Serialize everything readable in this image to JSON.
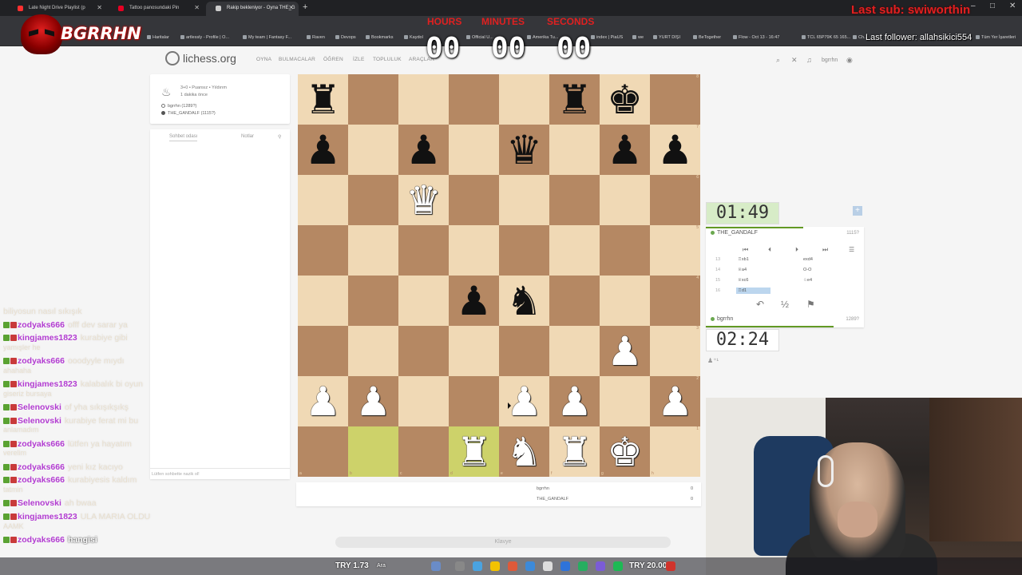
{
  "browser": {
    "tabs": [
      {
        "label": "Late Night Drive Playlist (p",
        "color": "#ff3030"
      },
      {
        "label": "Tattoo panosundaki Pin",
        "color": "#e60023"
      },
      {
        "label": "Rakip bekleniyor - Oyna THE_G",
        "color": "#cccccc"
      }
    ],
    "new_tab": "+",
    "window_controls": [
      "–",
      "□",
      "✕"
    ],
    "bookmarks": [
      "Haritalar",
      "artlessly - Profile | O...",
      "My team | Fantasy F...",
      "Raven",
      "Devops",
      "Bookmarks",
      "Kaydol",
      "Official U...",
      "Amerika Tu...",
      "index | PiaUS",
      "we",
      "YURT DIŞI",
      "BeTogether",
      "Flow - Oct 13 - 16:47",
      "TCL 65P79K 65 165...",
      "Ch...",
      "Tüm Yer İşaretleri"
    ]
  },
  "site": {
    "logo": "lichess.org",
    "nav": [
      "OYNA",
      "BULMACALAR",
      "ÖĞREN",
      "İZLE",
      "TOPLULUK",
      "ARAÇLAR"
    ],
    "header_icons": [
      "search-icon",
      "close-icon",
      "bell-icon"
    ],
    "username": "bgrrhn"
  },
  "game_info": {
    "line1": "3+0 • Puansız • Yıldırım",
    "line2": "1 dakika önce",
    "white_player": "bgrrhn (1289?)",
    "black_player": "THE_GANDALF (1115?)"
  },
  "chat": {
    "tab_chat": "Sohbet odası",
    "tab_notes": "Notlar",
    "placeholder": "Lütfen sohbette nazik ol!"
  },
  "board": {
    "ranks": [
      "8",
      "7",
      "6",
      "5",
      "4",
      "3",
      "2",
      "1"
    ],
    "files": [
      "a",
      "b",
      "c",
      "d",
      "e",
      "f",
      "g",
      "h"
    ],
    "position": [
      [
        "bR",
        "",
        "",
        "",
        "",
        "bR",
        "bK",
        ""
      ],
      [
        "bP",
        "",
        "bP",
        "",
        "bQ",
        "",
        "bP",
        "bP"
      ],
      [
        "",
        "",
        "wQ",
        "",
        "",
        "",
        "",
        ""
      ],
      [
        "",
        "",
        "",
        "",
        "",
        "",
        "",
        ""
      ],
      [
        "",
        "",
        "",
        "bP",
        "bN",
        "",
        "",
        ""
      ],
      [
        "",
        "",
        "",
        "",
        "",
        "",
        "wP",
        ""
      ],
      [
        "wP",
        "wP",
        "",
        "",
        "wP",
        "wP",
        "",
        "wP"
      ],
      [
        "",
        "",
        "",
        "wR",
        "wN",
        "wR",
        "wK",
        ""
      ]
    ],
    "highlight": [
      "b1",
      "d1"
    ]
  },
  "materials": {
    "rows": [
      {
        "name": "bgrrhn",
        "score": "0"
      },
      {
        "name": "THE_GANDALF",
        "score": "0"
      }
    ]
  },
  "keyboard_label": "Klavye",
  "clocks": {
    "top": "01:49",
    "bottom": "02:24"
  },
  "move_panel": {
    "top_player": "THE_GANDALF",
    "top_rating": "1115?",
    "bottom_player": "bgrrhn",
    "bottom_rating": "1289?",
    "moves": [
      {
        "n": "13",
        "w": "♖xb1",
        "b": "exd4"
      },
      {
        "n": "14",
        "w": "♕a4",
        "b": "O-O"
      },
      {
        "n": "15",
        "w": "♕xc6",
        "b": "♘e4"
      },
      {
        "n": "16",
        "w": "♖d1",
        "b": ""
      }
    ],
    "actions": {
      "takeback": "↶",
      "draw": "½",
      "resign": "⚑"
    },
    "add_time": "+"
  },
  "overlay": {
    "brand": "BGRRHN",
    "timer_labels": [
      "HOURS",
      "MINUTES",
      "SECONDS"
    ],
    "timer_values": [
      "00",
      "00",
      "00"
    ],
    "last_sub": "Last sub: swiworthin",
    "last_follower": "Last follower: allahsikici554"
  },
  "stream_chat": [
    {
      "user": "",
      "text": "biliyosun nasıl sıkışık"
    },
    {
      "user": "zodyaks666",
      "text": "offf dev sarar ya"
    },
    {
      "user": "kingjames1823",
      "text": "kurabiye gibi",
      "cont": "yamışler he"
    },
    {
      "user": "zodyaks666",
      "text": "ooodyyle mıydı",
      "cont": "ahahaha"
    },
    {
      "user": "kingjames1823",
      "text": "kalabalık bi oyun",
      "cont": "giseriz bursaya"
    },
    {
      "user": "Selenovski",
      "text": "of yha sıkışıkşıkş"
    },
    {
      "user": "Selenovski",
      "text": "kurabiye ferat mi bu",
      "cont": "anlamadım"
    },
    {
      "user": "zodyaks666",
      "text": "lütfen ya hayatım",
      "cont": "verelim"
    },
    {
      "user": "zodyaks666",
      "text": "yeni kız kacıyo"
    },
    {
      "user": "zodyaks666",
      "text": "kurabiyesis kaldım",
      "cont": "tatmin"
    },
    {
      "user": "Selenovski",
      "text": "ah bwaa"
    },
    {
      "user": "kingjames1823",
      "text": "ULA MARIA OLDU",
      "cont": "AAMK"
    },
    {
      "user": "zodyaks666",
      "text": "hangisi"
    }
  ],
  "taskbar": {
    "weather_left": "TRY 1.73",
    "search": "Ara",
    "weather_right": "TRY 20.00"
  }
}
